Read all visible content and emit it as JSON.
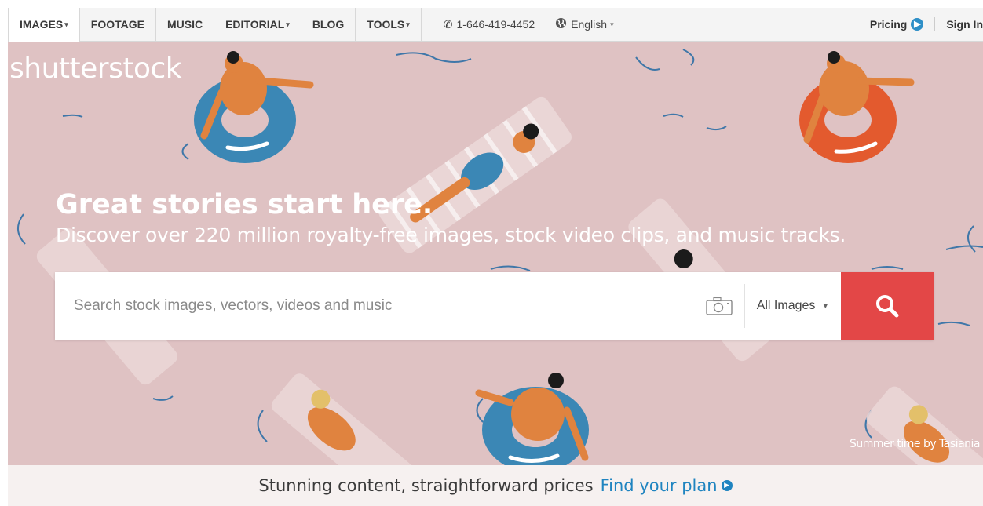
{
  "nav": {
    "items": [
      {
        "label": "IMAGES",
        "has_caret": true,
        "active": true
      },
      {
        "label": "FOOTAGE",
        "has_caret": false
      },
      {
        "label": "MUSIC",
        "has_caret": false
      },
      {
        "label": "EDITORIAL",
        "has_caret": true
      },
      {
        "label": "BLOG",
        "has_caret": false
      },
      {
        "label": "TOOLS",
        "has_caret": true
      }
    ],
    "caret": "▾",
    "phone": "1-646-419-4452",
    "phone_icon": "phone-icon",
    "language": "English",
    "language_icon": "globe-icon",
    "pricing": "Pricing",
    "pricing_icon": "chevron-right-circle-icon",
    "sign_in": "Sign In"
  },
  "hero": {
    "logo": "shutterstock",
    "headline": "Great stories start here.",
    "subline": "Discover over 220 million royalty-free images, stock video clips, and music tracks.",
    "image_credit": "Summer time by Tasiania",
    "background_color": "#dfc2c3"
  },
  "search": {
    "placeholder": "Search stock images, vectors, videos and music",
    "value": "",
    "camera_icon": "camera-icon",
    "type_selected": "All Images",
    "button_icon": "search-icon",
    "button_color": "#e34747"
  },
  "promo": {
    "text": "Stunning content, straightforward prices",
    "link": "Find your plan",
    "link_icon": "chevron-right-circle-icon",
    "link_color": "#1f84c0"
  }
}
